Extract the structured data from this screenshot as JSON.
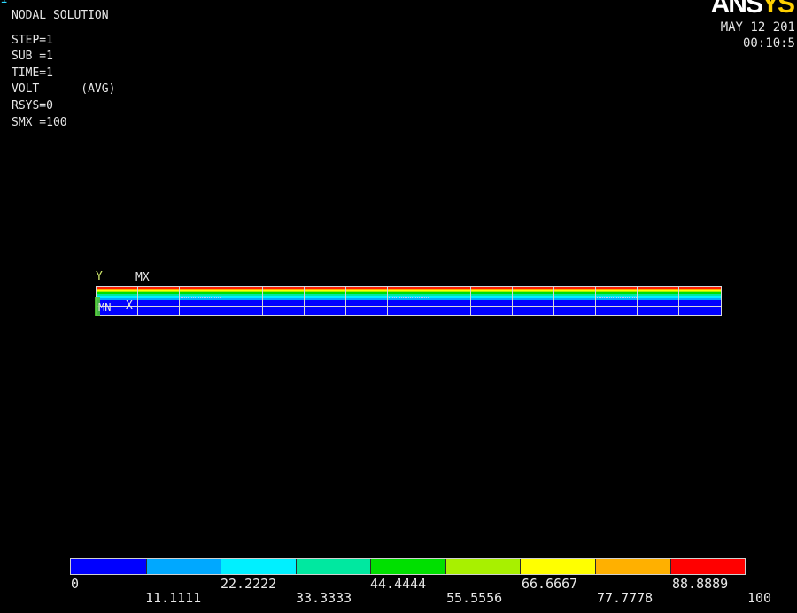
{
  "header": {
    "window_marker": "1",
    "title": "NODAL SOLUTION",
    "step": "STEP=1",
    "sub": "SUB =1",
    "time": "TIME=1",
    "volt": "VOLT      (AVG)",
    "rsys": "RSYS=0",
    "smx": "SMX =100"
  },
  "logo": {
    "part_white": "ANS",
    "part_yellow": "YS"
  },
  "timestamp": {
    "date": "MAY 12 201",
    "time": "00:10:5"
  },
  "plot": {
    "mx_label": "MX",
    "mn_label": "MN",
    "x_axis_label": "X",
    "y_axis_label": "Y"
  },
  "legend": {
    "colors": [
      "#0000ff",
      "#00a8ff",
      "#00f0ff",
      "#00e8a0",
      "#00e000",
      "#a8f000",
      "#ffff00",
      "#ffb000",
      "#ff0000"
    ],
    "ticks_top": [
      "0",
      "22.2222",
      "44.4444",
      "66.6667",
      "88.8889"
    ],
    "ticks_bottom": [
      "11.1111",
      "33.3333",
      "55.5556",
      "77.7778",
      "100"
    ]
  }
}
